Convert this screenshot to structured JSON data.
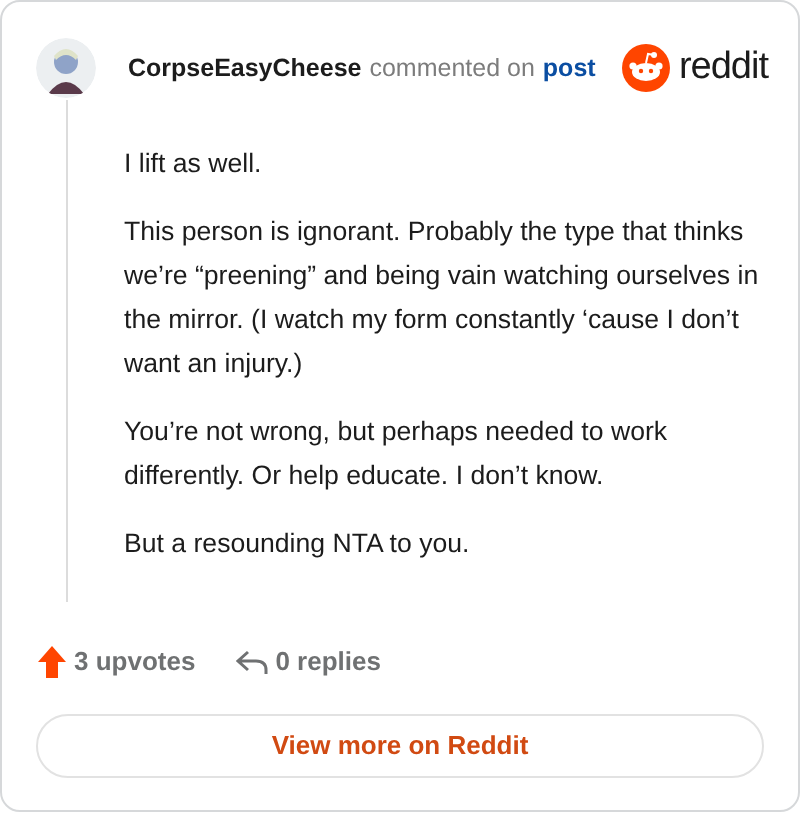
{
  "header": {
    "author": "CorpseEasyCheese",
    "action": "commented on",
    "link": "post",
    "logo_text": "reddit"
  },
  "paragraphs": [
    "I lift as well.",
    "This person is ignorant. Probably the type that thinks we’re “preening” and being vain watching ourselves in the mirror. (I watch my form constantly ‘cause I don’t want an injury.)",
    "You’re not wrong, but perhaps needed to work differently. Or help educate. I don’t know.",
    "But a resounding NTA to you."
  ],
  "footer": {
    "upvotes": "3 upvotes",
    "replies": "0 replies",
    "button": "View more on Reddit"
  }
}
